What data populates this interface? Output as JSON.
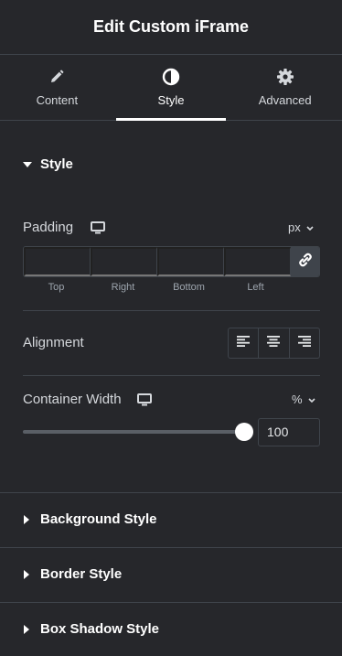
{
  "header": {
    "title": "Edit Custom iFrame"
  },
  "tabs": [
    {
      "label": "Content",
      "icon": "pencil-icon"
    },
    {
      "label": "Style",
      "icon": "contrast-icon",
      "active": true
    },
    {
      "label": "Advanced",
      "icon": "gear-icon"
    }
  ],
  "style_section": {
    "title": "Style",
    "padding": {
      "label": "Padding",
      "device_icon": "desktop-icon",
      "unit": "px",
      "fields": [
        {
          "label": "Top",
          "value": ""
        },
        {
          "label": "Right",
          "value": ""
        },
        {
          "label": "Bottom",
          "value": ""
        },
        {
          "label": "Left",
          "value": ""
        }
      ],
      "link_icon": "link-icon"
    },
    "alignment": {
      "label": "Alignment",
      "options": [
        "align-left-icon",
        "align-center-icon",
        "align-right-icon"
      ]
    },
    "container_width": {
      "label": "Container Width",
      "device_icon": "desktop-icon",
      "unit": "%",
      "value": "100",
      "slider_level": 100
    }
  },
  "collapsed_sections": [
    {
      "title": "Background Style"
    },
    {
      "title": "Border Style"
    },
    {
      "title": "Box Shadow Style"
    }
  ],
  "colors": {
    "panel_bg": "#26272b",
    "border": "#3f444b",
    "text": "#d5d8dc",
    "heading": "#ffffff",
    "link_button_bg": "#3f444b"
  }
}
